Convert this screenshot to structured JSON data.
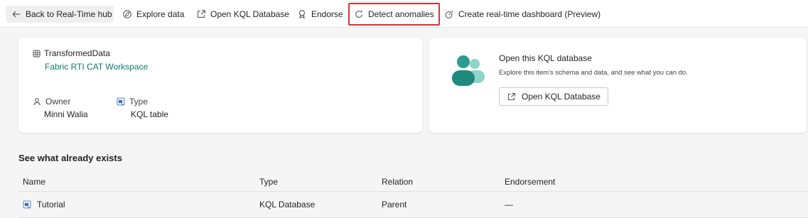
{
  "toolbar": {
    "back_label": "Back to Real-Time hub",
    "explore_label": "Explore data",
    "open_kql_label": "Open KQL Database",
    "endorse_label": "Endorse",
    "detect_label": "Detect anomalies",
    "dashboard_label": "Create real-time dashboard (Preview)"
  },
  "info_card": {
    "item_name": "TransformedData",
    "workspace": "Fabric RTI CAT Workspace",
    "owner_label": "Owner",
    "owner_value": "Minni Walia",
    "type_label": "Type",
    "type_value": "KQL table"
  },
  "open_card": {
    "title": "Open this KQL database",
    "description": "Explore this item's schema and data, and see what you can do.",
    "button_label": "Open KQL Database"
  },
  "section": {
    "title": "See what already exists"
  },
  "table": {
    "headers": [
      "Name",
      "Type",
      "Relation",
      "Endorsement"
    ],
    "rows": [
      {
        "name": "Tutorial",
        "type": "KQL Database",
        "relation": "Parent",
        "endorsement": "—"
      }
    ]
  },
  "colors": {
    "highlight_border": "#d13438",
    "link": "#0f7b6c",
    "accent_teal": "#2a9d8f"
  }
}
